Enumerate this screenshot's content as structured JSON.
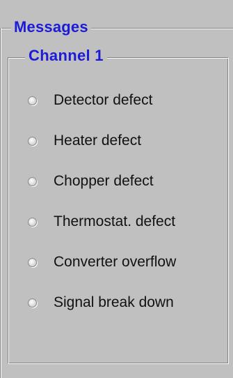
{
  "messages_group": {
    "title": "Messages"
  },
  "channel_group": {
    "title": "Channel 1",
    "items": [
      {
        "label": "Detector defect",
        "icon": "status-led-off"
      },
      {
        "label": "Heater defect",
        "icon": "status-led-off"
      },
      {
        "label": "Chopper defect",
        "icon": "status-led-off"
      },
      {
        "label": "Thermostat. defect",
        "icon": "status-led-off"
      },
      {
        "label": "Converter overflow",
        "icon": "status-led-off"
      },
      {
        "label": "Signal break down",
        "icon": "status-led-off"
      }
    ]
  },
  "colors": {
    "title_blue": "#1c1cd8",
    "panel_gray": "#c0c0c0"
  }
}
